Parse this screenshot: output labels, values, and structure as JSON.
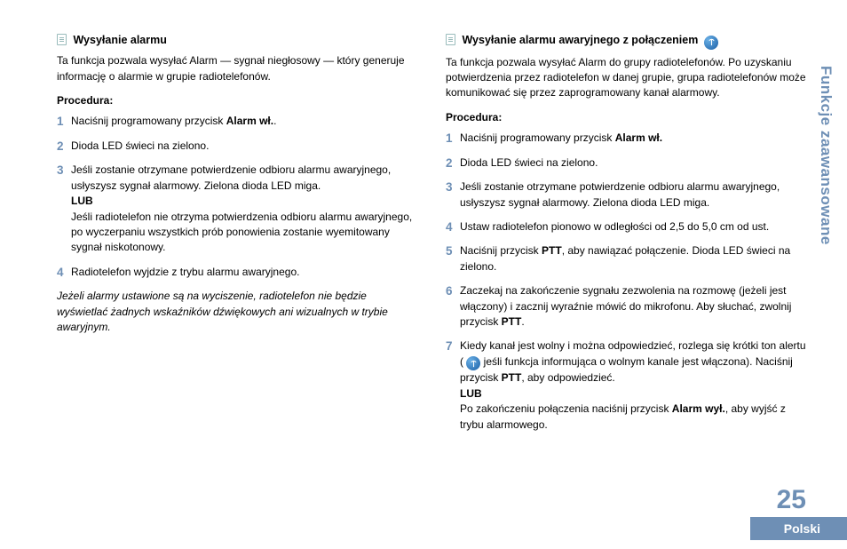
{
  "sideTab": "Funkcje zaawansowane",
  "pageNumber": "25",
  "langTab": "Polski",
  "left": {
    "heading": "Wysyłanie alarmu",
    "intro": "Ta funkcja pozwala wysyłać Alarm — sygnał niegłosowy — który generuje informację o alarmie w grupie radiotelefonów.",
    "procLabel": "Procedura:",
    "steps": [
      {
        "num": "1",
        "pre": "Naciśnij programowany przycisk ",
        "b1": "Alarm wł.",
        "post1": "."
      },
      {
        "num": "2",
        "pre": "Dioda LED świeci na zielono."
      },
      {
        "num": "3",
        "pre": "Jeśli zostanie otrzymane potwierdzenie odbioru alarmu awaryjnego, usłyszysz sygnał alarmowy. Zielona dioda LED miga.",
        "lub": "LUB",
        "after": "Jeśli radiotelefon nie otrzyma potwierdzenia odbioru alarmu awaryjnego, po wyczerpaniu wszystkich prób ponowienia zostanie wyemitowany sygnał niskotonowy."
      },
      {
        "num": "4",
        "pre": "Radiotelefon wyjdzie z trybu alarmu awaryjnego."
      }
    ],
    "note": "Jeżeli alarmy ustawione są na wyciszenie, radiotelefon nie będzie wyświetlać żadnych wskaźników dźwiękowych ani wizualnych w trybie awaryjnym."
  },
  "right": {
    "heading": "Wysyłanie alarmu awaryjnego z połączeniem",
    "intro": "Ta funkcja pozwala wysyłać Alarm do grupy radiotelefonów. Po uzyskaniu potwierdzenia przez radiotelefon w danej grupie, grupa radiotelefonów może komunikować się przez zaprogramowany kanał alarmowy.",
    "procLabel": "Procedura:",
    "steps": [
      {
        "num": "1",
        "pre": "Naciśnij programowany przycisk ",
        "b1": "Alarm wł."
      },
      {
        "num": "2",
        "pre": "Dioda LED świeci na zielono."
      },
      {
        "num": "3",
        "pre": "Jeśli zostanie otrzymane potwierdzenie odbioru alarmu awaryjnego, usłyszysz sygnał alarmowy. Zielona dioda LED miga."
      },
      {
        "num": "4",
        "pre": "Ustaw radiotelefon pionowo w odległości od 2,5 do 5,0 cm od ust."
      },
      {
        "num": "5",
        "pre": "Naciśnij przycisk ",
        "b1": "PTT",
        "post1": ", aby nawiązać połączenie. Dioda LED świeci na zielono."
      },
      {
        "num": "6",
        "pre": "Zaczekaj na zakończenie sygnału zezwolenia na rozmowę (jeżeli jest włączony) i zacznij wyraźnie mówić do mikrofonu. Aby słuchać, zwolnij przycisk ",
        "b1": "PTT",
        "post1": "."
      },
      {
        "num": "7",
        "pre": "Kiedy kanał jest wolny i można odpowiedzieć, rozlega się krótki ton alertu ( ",
        "iconMid": true,
        "mid": " jeśli funkcja informująca o wolnym kanale jest włączona). Naciśnij przycisk ",
        "b1": "PTT",
        "post1": ", aby odpowiedzieć.",
        "lub": "LUB",
        "after_pre": "Po zakończeniu połączenia naciśnij przycisk ",
        "after_b": "Alarm wył.",
        "after_post": ", aby wyjść z trybu alarmowego."
      }
    ]
  }
}
